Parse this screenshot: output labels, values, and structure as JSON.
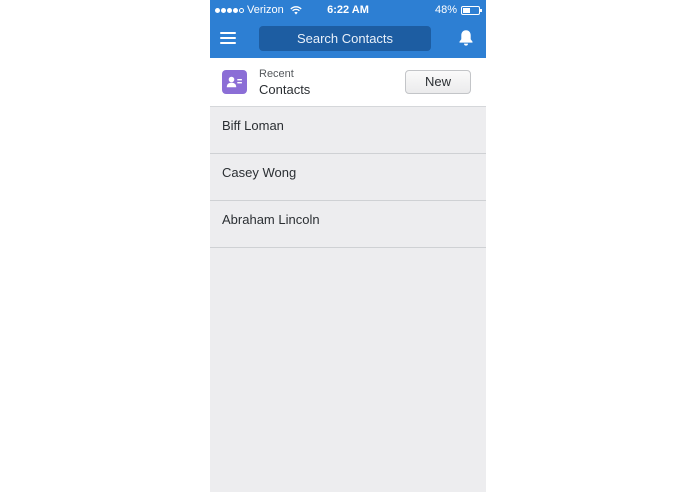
{
  "status_bar": {
    "carrier": "Verizon",
    "time": "6:22 AM",
    "battery_percent": "48%",
    "battery_level": 0.48,
    "signal_bars": 4
  },
  "nav": {
    "search_placeholder": "Search Contacts",
    "menu_icon": "menu-icon",
    "notifications_icon": "bell-icon",
    "header_color": "#2d7fd3"
  },
  "recent": {
    "label": "Recent",
    "title": "Contacts",
    "icon": "contact-card-icon",
    "icon_color": "#8b6ed6",
    "new_button_label": "New"
  },
  "contacts": [
    {
      "name": "Biff Loman"
    },
    {
      "name": "Casey Wong"
    },
    {
      "name": "Abraham Lincoln"
    }
  ]
}
